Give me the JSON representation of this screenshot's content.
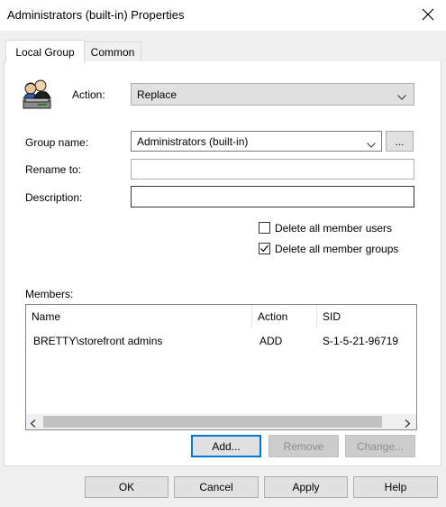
{
  "window": {
    "title": "Administrators (built-in) Properties"
  },
  "tabs": [
    {
      "label": "Local Group",
      "active": true
    },
    {
      "label": "Common",
      "active": false
    }
  ],
  "form": {
    "action_label": "Action:",
    "action_value": "Replace",
    "group_name_label": "Group name:",
    "group_name_value": "Administrators (built-in)",
    "browse_label": "...",
    "rename_label": "Rename to:",
    "rename_value": "",
    "description_label": "Description:",
    "description_value": "",
    "delete_users_label": "Delete all member users",
    "delete_users_checked": false,
    "delete_groups_label": "Delete all member groups",
    "delete_groups_checked": true
  },
  "members": {
    "label": "Members:",
    "columns": [
      "Name",
      "Action",
      "SID"
    ],
    "rows": [
      {
        "name": "BRETTY\\storefront admins",
        "action": "ADD",
        "sid": "S-1-5-21-96719"
      }
    ]
  },
  "member_buttons": {
    "add": "Add...",
    "remove": "Remove",
    "change": "Change..."
  },
  "dialog_buttons": {
    "ok": "OK",
    "cancel": "Cancel",
    "apply": "Apply",
    "help": "Help"
  }
}
